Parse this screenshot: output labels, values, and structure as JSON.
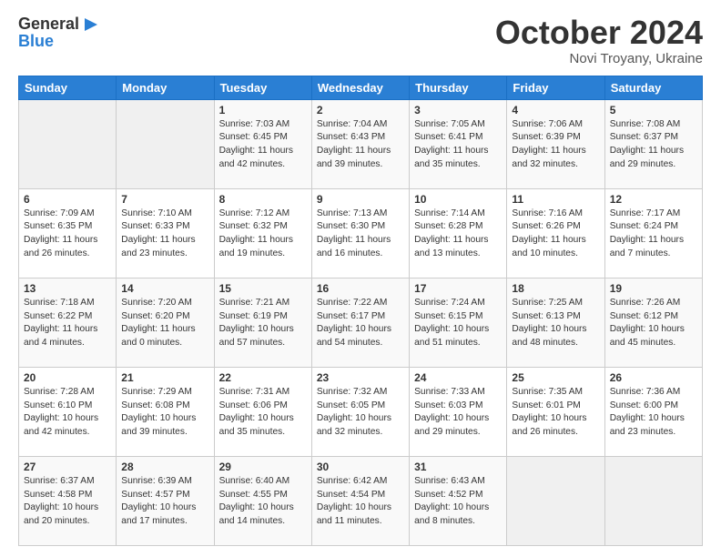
{
  "logo": {
    "line1": "General",
    "line2": "Blue"
  },
  "header": {
    "month": "October 2024",
    "location": "Novi Troyany, Ukraine"
  },
  "weekdays": [
    "Sunday",
    "Monday",
    "Tuesday",
    "Wednesday",
    "Thursday",
    "Friday",
    "Saturday"
  ],
  "weeks": [
    [
      {
        "day": "",
        "info": ""
      },
      {
        "day": "",
        "info": ""
      },
      {
        "day": "1",
        "info": "Sunrise: 7:03 AM\nSunset: 6:45 PM\nDaylight: 11 hours and 42 minutes."
      },
      {
        "day": "2",
        "info": "Sunrise: 7:04 AM\nSunset: 6:43 PM\nDaylight: 11 hours and 39 minutes."
      },
      {
        "day": "3",
        "info": "Sunrise: 7:05 AM\nSunset: 6:41 PM\nDaylight: 11 hours and 35 minutes."
      },
      {
        "day": "4",
        "info": "Sunrise: 7:06 AM\nSunset: 6:39 PM\nDaylight: 11 hours and 32 minutes."
      },
      {
        "day": "5",
        "info": "Sunrise: 7:08 AM\nSunset: 6:37 PM\nDaylight: 11 hours and 29 minutes."
      }
    ],
    [
      {
        "day": "6",
        "info": "Sunrise: 7:09 AM\nSunset: 6:35 PM\nDaylight: 11 hours and 26 minutes."
      },
      {
        "day": "7",
        "info": "Sunrise: 7:10 AM\nSunset: 6:33 PM\nDaylight: 11 hours and 23 minutes."
      },
      {
        "day": "8",
        "info": "Sunrise: 7:12 AM\nSunset: 6:32 PM\nDaylight: 11 hours and 19 minutes."
      },
      {
        "day": "9",
        "info": "Sunrise: 7:13 AM\nSunset: 6:30 PM\nDaylight: 11 hours and 16 minutes."
      },
      {
        "day": "10",
        "info": "Sunrise: 7:14 AM\nSunset: 6:28 PM\nDaylight: 11 hours and 13 minutes."
      },
      {
        "day": "11",
        "info": "Sunrise: 7:16 AM\nSunset: 6:26 PM\nDaylight: 11 hours and 10 minutes."
      },
      {
        "day": "12",
        "info": "Sunrise: 7:17 AM\nSunset: 6:24 PM\nDaylight: 11 hours and 7 minutes."
      }
    ],
    [
      {
        "day": "13",
        "info": "Sunrise: 7:18 AM\nSunset: 6:22 PM\nDaylight: 11 hours and 4 minutes."
      },
      {
        "day": "14",
        "info": "Sunrise: 7:20 AM\nSunset: 6:20 PM\nDaylight: 11 hours and 0 minutes."
      },
      {
        "day": "15",
        "info": "Sunrise: 7:21 AM\nSunset: 6:19 PM\nDaylight: 10 hours and 57 minutes."
      },
      {
        "day": "16",
        "info": "Sunrise: 7:22 AM\nSunset: 6:17 PM\nDaylight: 10 hours and 54 minutes."
      },
      {
        "day": "17",
        "info": "Sunrise: 7:24 AM\nSunset: 6:15 PM\nDaylight: 10 hours and 51 minutes."
      },
      {
        "day": "18",
        "info": "Sunrise: 7:25 AM\nSunset: 6:13 PM\nDaylight: 10 hours and 48 minutes."
      },
      {
        "day": "19",
        "info": "Sunrise: 7:26 AM\nSunset: 6:12 PM\nDaylight: 10 hours and 45 minutes."
      }
    ],
    [
      {
        "day": "20",
        "info": "Sunrise: 7:28 AM\nSunset: 6:10 PM\nDaylight: 10 hours and 42 minutes."
      },
      {
        "day": "21",
        "info": "Sunrise: 7:29 AM\nSunset: 6:08 PM\nDaylight: 10 hours and 39 minutes."
      },
      {
        "day": "22",
        "info": "Sunrise: 7:31 AM\nSunset: 6:06 PM\nDaylight: 10 hours and 35 minutes."
      },
      {
        "day": "23",
        "info": "Sunrise: 7:32 AM\nSunset: 6:05 PM\nDaylight: 10 hours and 32 minutes."
      },
      {
        "day": "24",
        "info": "Sunrise: 7:33 AM\nSunset: 6:03 PM\nDaylight: 10 hours and 29 minutes."
      },
      {
        "day": "25",
        "info": "Sunrise: 7:35 AM\nSunset: 6:01 PM\nDaylight: 10 hours and 26 minutes."
      },
      {
        "day": "26",
        "info": "Sunrise: 7:36 AM\nSunset: 6:00 PM\nDaylight: 10 hours and 23 minutes."
      }
    ],
    [
      {
        "day": "27",
        "info": "Sunrise: 6:37 AM\nSunset: 4:58 PM\nDaylight: 10 hours and 20 minutes."
      },
      {
        "day": "28",
        "info": "Sunrise: 6:39 AM\nSunset: 4:57 PM\nDaylight: 10 hours and 17 minutes."
      },
      {
        "day": "29",
        "info": "Sunrise: 6:40 AM\nSunset: 4:55 PM\nDaylight: 10 hours and 14 minutes."
      },
      {
        "day": "30",
        "info": "Sunrise: 6:42 AM\nSunset: 4:54 PM\nDaylight: 10 hours and 11 minutes."
      },
      {
        "day": "31",
        "info": "Sunrise: 6:43 AM\nSunset: 4:52 PM\nDaylight: 10 hours and 8 minutes."
      },
      {
        "day": "",
        "info": ""
      },
      {
        "day": "",
        "info": ""
      }
    ]
  ]
}
